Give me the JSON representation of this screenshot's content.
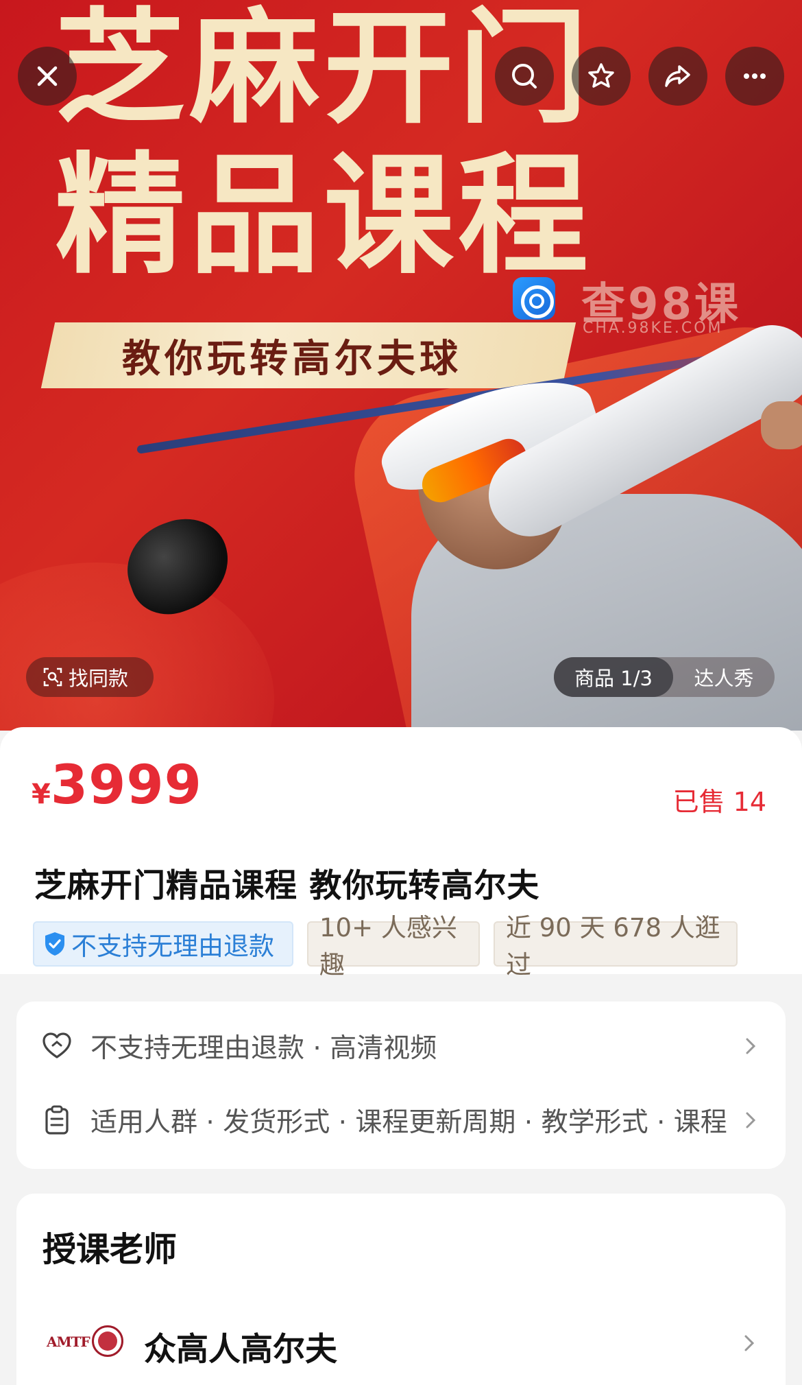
{
  "hero": {
    "title_line1": "芝麻开门",
    "title_line2": "精品课程",
    "banner": "教你玩转高尔夫球",
    "watermark": "查98课",
    "watermark_sub": "CHA.98KE.COM",
    "find_same": "找同款",
    "pager_current": "商品 1/3",
    "pager_other": "达人秀"
  },
  "top_icons": [
    "close-icon",
    "search-icon",
    "star-icon",
    "share-icon",
    "more-icon"
  ],
  "product": {
    "currency": "¥",
    "price": "3999",
    "sold": "已售 14",
    "title": "芝麻开门精品课程 教你玩转高尔夫",
    "tags": [
      "不支持无理由退款",
      "10+ 人感兴趣",
      "近 90 天 678 人逛过"
    ]
  },
  "service": {
    "row1": "不支持无理由退款 · 高清视频",
    "row2": "适用人群 · 发货形式 · 课程更新周期 · 教学形式 · 课程..."
  },
  "teacher": {
    "heading": "授课老师",
    "logo_text": "AMTF",
    "name": "众高人高尔夫"
  },
  "colors": {
    "accent_red": "#e62b35",
    "tag_blue": "#2b7fd6",
    "hero_red": "#c8171d"
  }
}
